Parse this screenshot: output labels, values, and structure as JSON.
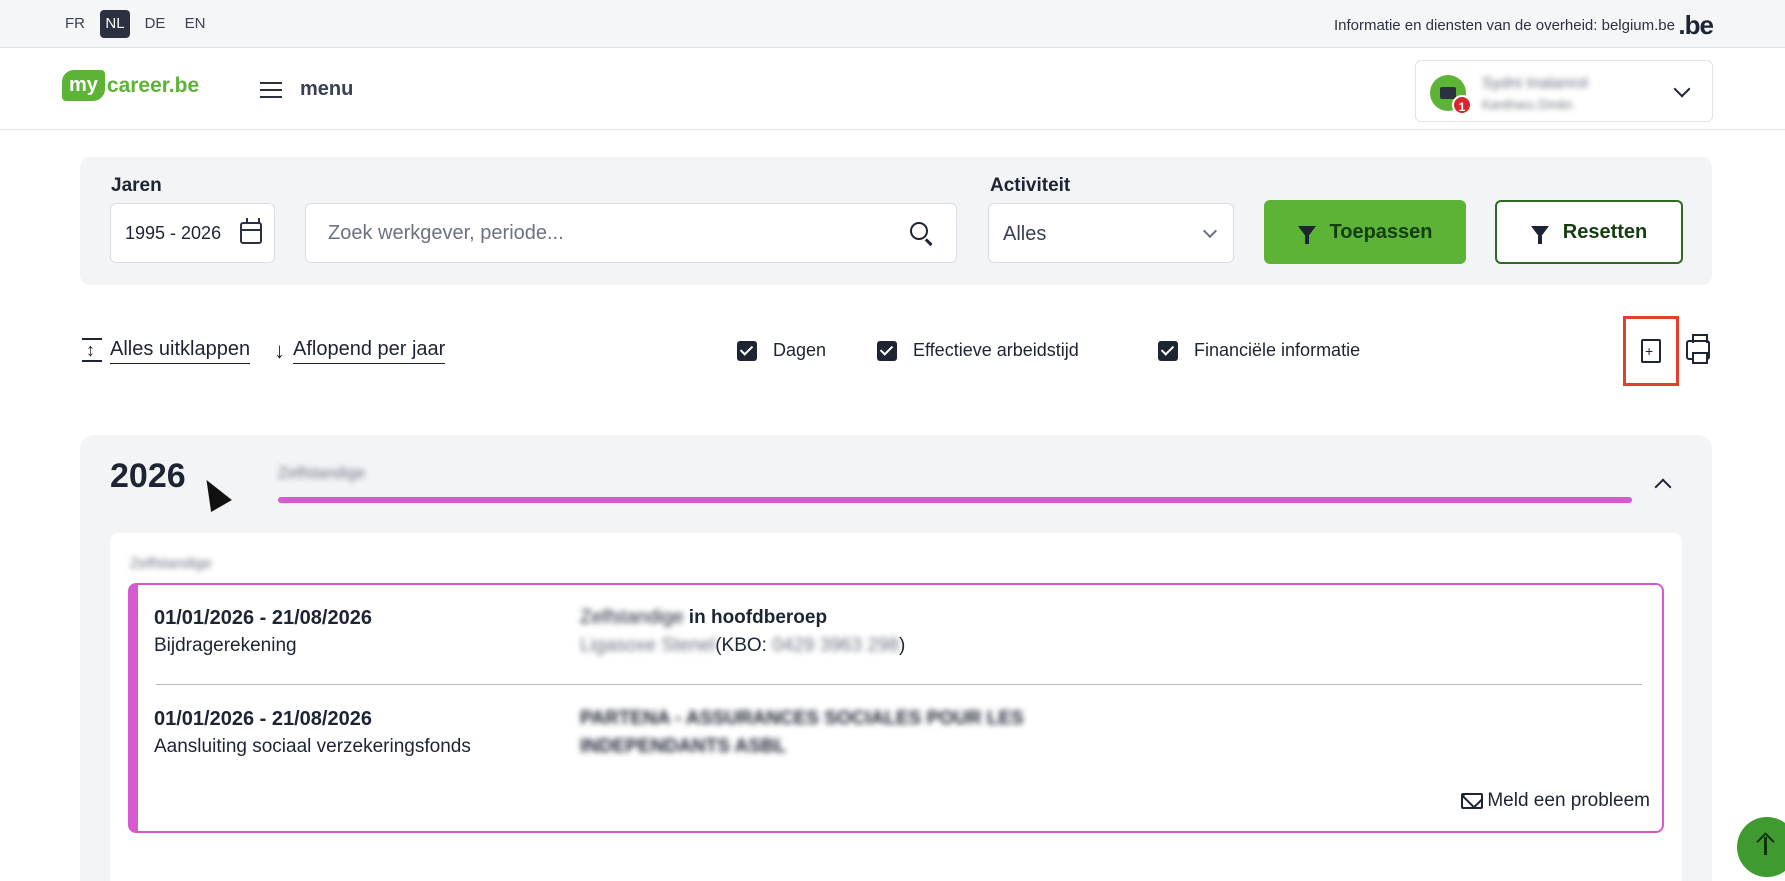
{
  "lang_bar": {
    "languages": [
      "FR",
      "NL",
      "DE",
      "EN"
    ],
    "active": "NL",
    "gov_text": "Informatie en diensten van de overheid: belgium.be",
    "be_logo": ".be"
  },
  "header": {
    "logo_my": "my",
    "logo_career": "career.be",
    "menu_label": "menu",
    "user": {
      "name": "Sydni Inalanrol",
      "subtitle": "Kantharu Dmitn",
      "badge_count": "1"
    }
  },
  "filters": {
    "years_label": "Jaren",
    "years_value": "1995 - 2026",
    "search_placeholder": "Zoek werkgever, periode...",
    "activity_label": "Activiteit",
    "activity_value": "Alles",
    "apply_label": "Toepassen",
    "reset_label": "Resetten"
  },
  "toolbar": {
    "expand_all": "Alles uitklappen",
    "sort": "Aflopend per jaar",
    "checkboxes": [
      {
        "label": "Dagen",
        "checked": true
      },
      {
        "label": "Effectieve arbeidstijd",
        "checked": true
      },
      {
        "label": "Financiële informatie",
        "checked": true
      }
    ]
  },
  "year_section": {
    "year": "2026",
    "timeline_label": "Zelfstandige",
    "timeline_color": "#d55ad0",
    "category_label": "Zelfstandige",
    "entries": [
      {
        "date": "01/01/2026 - 21/08/2026",
        "desc": "Bijdragerekening",
        "right_blur": "Zelfstandige",
        "right_bold": " in hoofdberoep",
        "sub_blur": "Ligasoxe Stenel",
        "sub_kbo_prefix": "(KBO: ",
        "sub_kbo_blur": "0429 3963 298",
        "sub_kbo_suffix": ")"
      },
      {
        "date": "01/01/2026 - 21/08/2026",
        "desc": "Aansluiting sociaal verzekeringsfonds",
        "right_line1": "PARTENA - ASSURANCES SOCIALES POUR LES",
        "right_line2": "INDEPENDANTS ASBL"
      }
    ],
    "report_label": "Meld een probleem"
  }
}
